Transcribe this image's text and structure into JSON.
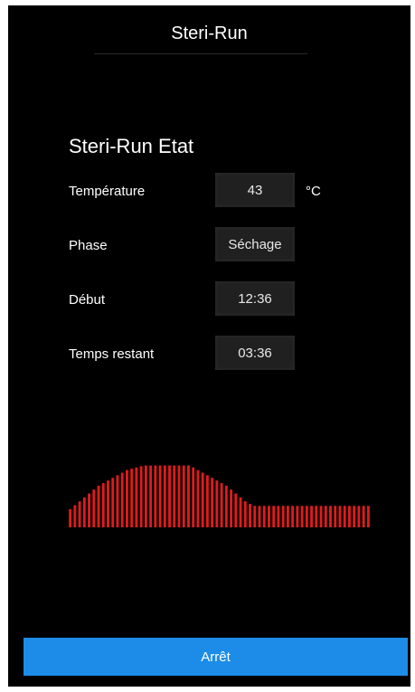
{
  "app": {
    "title": "Steri-Run"
  },
  "status": {
    "heading": "Steri-Run Etat",
    "rows": [
      {
        "label": "Température",
        "value": "43",
        "unit": "°C"
      },
      {
        "label": "Phase",
        "value": "Séchage",
        "unit": ""
      },
      {
        "label": "Début",
        "value": "12:36",
        "unit": ""
      },
      {
        "label": "Temps restant",
        "value": "03:36",
        "unit": ""
      }
    ]
  },
  "chart_data": {
    "type": "bar",
    "color": "#e01b1b",
    "title": "",
    "xlabel": "",
    "ylabel": "",
    "ylim": [
      0,
      100
    ],
    "values": [
      28,
      34,
      40,
      46,
      52,
      58,
      64,
      68,
      72,
      76,
      80,
      84,
      88,
      90,
      92,
      94,
      95,
      95,
      95,
      95,
      95,
      95,
      95,
      95,
      95,
      95,
      92,
      88,
      84,
      80,
      76,
      72,
      68,
      64,
      58,
      52,
      46,
      40,
      36,
      33,
      33,
      33,
      33,
      33,
      33,
      33,
      33,
      33,
      33,
      33,
      33,
      33,
      33,
      33,
      33,
      33,
      33,
      33,
      33,
      33,
      33,
      33,
      33,
      33
    ]
  },
  "footer": {
    "stop_label": "Arrêt"
  },
  "colors": {
    "background": "#000000",
    "accent": "#1d8ce8",
    "chart_red": "#e01b1b"
  }
}
